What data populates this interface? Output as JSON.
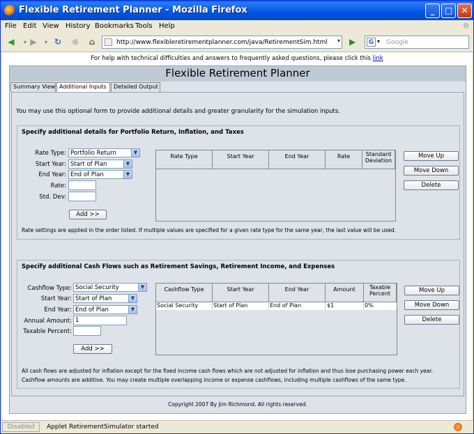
{
  "window": {
    "title": "Flexible Retirement Planner - Mozilla Firefox"
  },
  "menu": [
    "File",
    "Edit",
    "View",
    "History",
    "Bookmarks",
    "Tools",
    "Help"
  ],
  "toolbar": {
    "url": "http://www.flexibleretirementplanner.com/java/RetirementSim.html",
    "search_placeholder": "Google"
  },
  "help": {
    "text": "For help with technical difficulties and answers to frequently asked questions, please click this",
    "link": "link"
  },
  "app": {
    "title": "Flexible Retirement Planner",
    "tabs": [
      "Summary View",
      "Additional Inputs",
      "Detailed Output"
    ],
    "intro": "You may use this optional form to provide additional details and greater granularity for the simulation inputs.",
    "rates": {
      "title": "Specify additional details for Portfolio Return, Inflation, and Taxes",
      "labels": {
        "rate_type": "Rate Type:",
        "start_year": "Start Year:",
        "end_year": "End Year:",
        "rate": "Rate:",
        "std_dev": "Std. Dev:"
      },
      "values": {
        "rate_type": "Portfolio Return",
        "start_year": "Start of Plan",
        "end_year": "End of Plan",
        "rate": "",
        "std_dev": ""
      },
      "add": "Add >>",
      "columns": [
        "Rate Type",
        "Start Year",
        "End Year",
        "Rate",
        "Standard Deviation"
      ],
      "rows": [],
      "buttons": {
        "move_up": "Move Up",
        "move_down": "Move Down",
        "delete": "Delete"
      },
      "note": "Rate settings are applied in the order listed. If multiple values are specified for a given rate type for the same year, the last value will be used."
    },
    "cashflows": {
      "title": "Specify additional Cash Flows such as Retirement Savings, Retirement Income, and Expenses",
      "labels": {
        "type": "Cashflow Type:",
        "start_year": "Start Year:",
        "end_year": "End Year:",
        "amount": "Annual Amount:",
        "taxable": "Taxable Percent:"
      },
      "values": {
        "type": "Social Security",
        "start_year": "Start of Plan",
        "end_year": "End of Plan",
        "amount": "1",
        "taxable": ""
      },
      "add": "Add >>",
      "columns": [
        "Cashflow Type",
        "Start Year",
        "End Year",
        "Amount",
        "Taxable Percent"
      ],
      "rows": [
        [
          "Social Security",
          "Start of Plan",
          "End of Plan",
          "$1",
          "0%"
        ]
      ],
      "buttons": {
        "move_up": "Move Up",
        "move_down": "Move Down",
        "delete": "Delete"
      },
      "note1": "All cash flows are adjusted for inflation except for the fixed income cash flows which are not adjusted for inflation and thus lose purchasing power each year.",
      "note2": "Cashflow amounts are additive. You may create multiple overlapping income or expense cashflows, including multiple cashflows of the same type."
    },
    "copyright": "Copyright 2007 By Jim Richmond. All rights reserved."
  },
  "status": {
    "disabled": "Disabled",
    "text": "Applet RetirementSimulator started"
  }
}
